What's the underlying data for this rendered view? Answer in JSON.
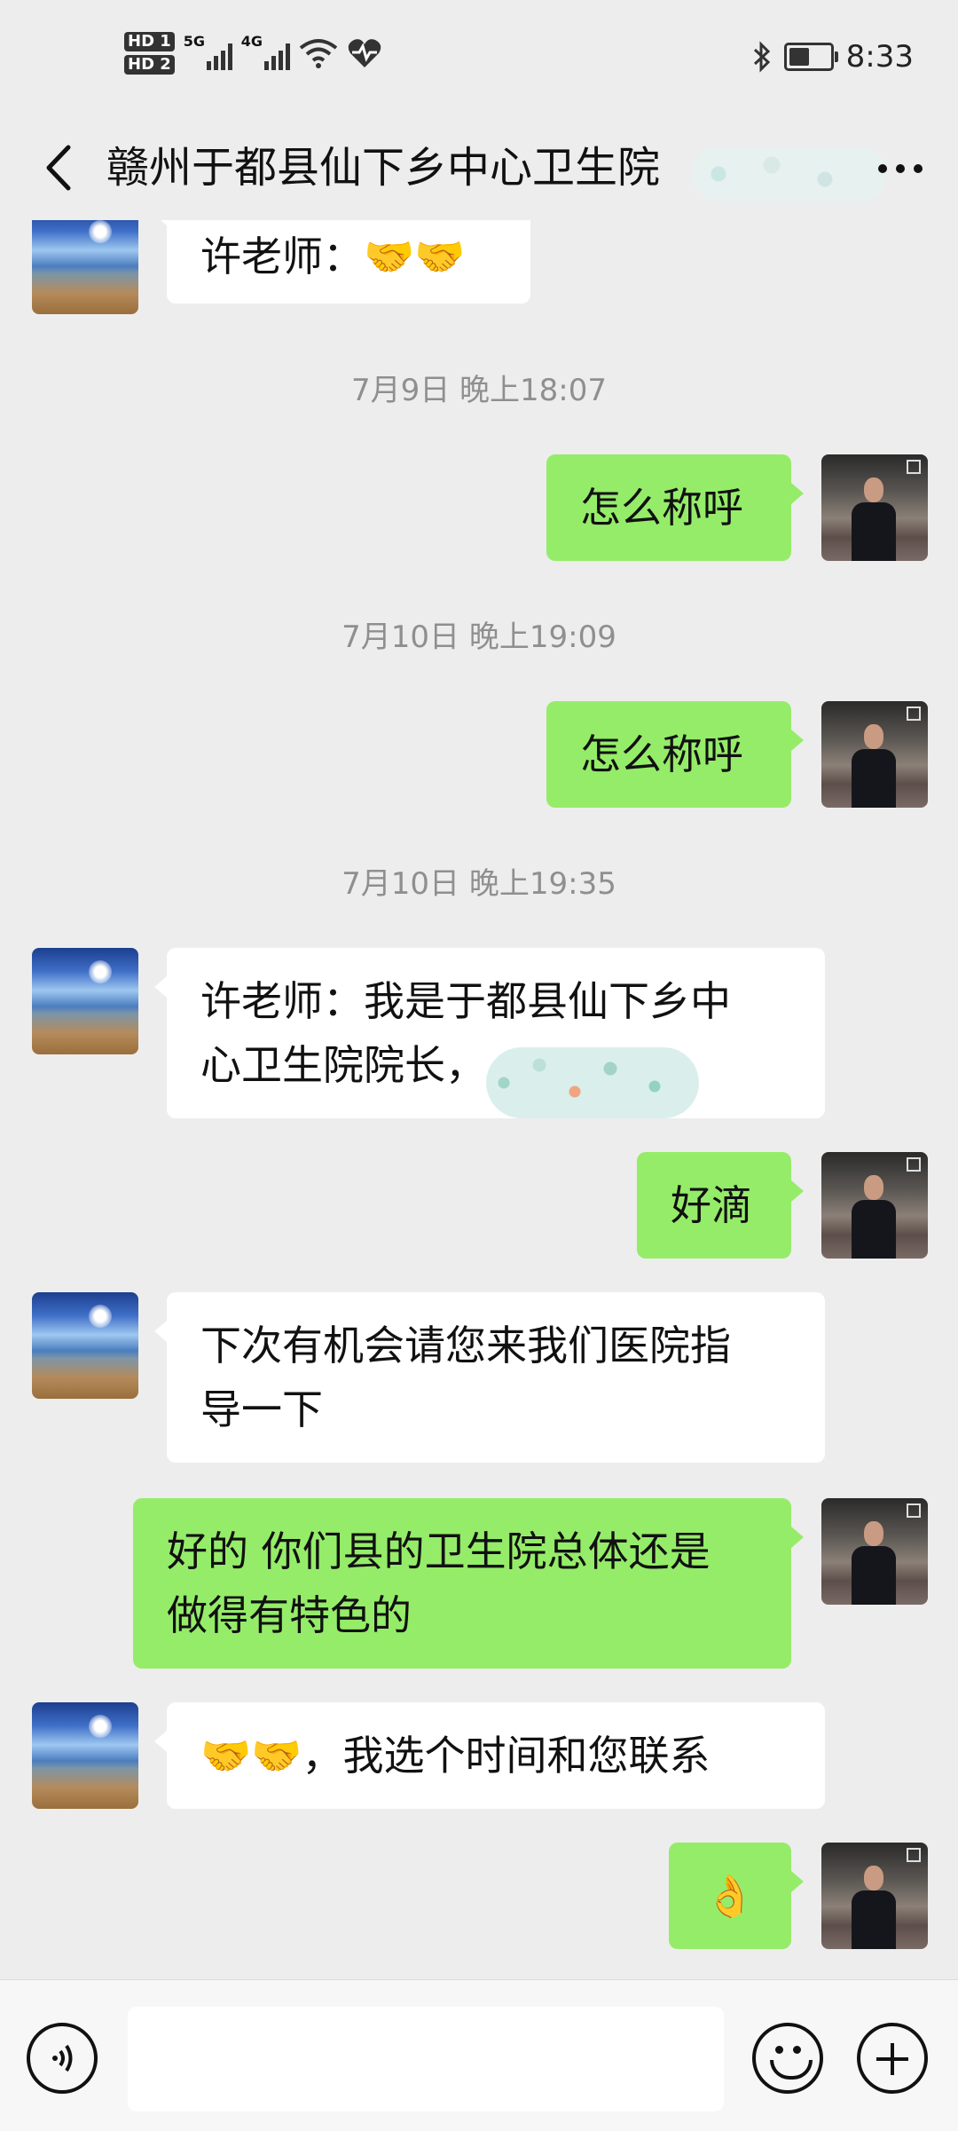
{
  "status_bar": {
    "hd1": "HD 1",
    "hd2": "HD 2",
    "net1": "5G",
    "net2": "4G",
    "time": "8:33",
    "icons": [
      "signal-icon",
      "wifi-icon",
      "heart-rate-icon",
      "bluetooth-icon",
      "battery-icon"
    ],
    "battery_level": 0.5
  },
  "header": {
    "title": "赣州于都县仙下乡中心卫生院",
    "back_icon": "chevron-left-icon",
    "more_icon": "more-dots-icon"
  },
  "messages": [
    {
      "type": "text",
      "side": "left",
      "text": "许老师：🤝🤝"
    },
    {
      "type": "time",
      "text": "7月9日 晚上18:07"
    },
    {
      "type": "text",
      "side": "right",
      "text": "怎么称呼"
    },
    {
      "type": "time",
      "text": "7月10日 晚上19:09"
    },
    {
      "type": "text",
      "side": "right",
      "text": "怎么称呼"
    },
    {
      "type": "time",
      "text": "7月10日 晚上19:35"
    },
    {
      "type": "text",
      "side": "left",
      "lines": [
        "许老师：我是于都县仙下乡中",
        "心卫生院院长，"
      ]
    },
    {
      "type": "text",
      "side": "right",
      "text": "好滴"
    },
    {
      "type": "text",
      "side": "left",
      "lines": [
        "下次有机会请您来我们医院指",
        "导一下"
      ]
    },
    {
      "type": "text",
      "side": "right",
      "lines": [
        "好的 你们县的卫生院总体还是",
        "做得有特色的"
      ]
    },
    {
      "type": "text",
      "side": "left",
      "text": "🤝🤝，我选个时间和您联系"
    },
    {
      "type": "text",
      "side": "right",
      "text": "👌"
    }
  ],
  "input_bar": {
    "voice_icon": "voice-icon",
    "emoji_icon": "emoji-icon",
    "plus_icon": "plus-icon",
    "input_value": ""
  },
  "colors": {
    "background": "#ededed",
    "bubble_sent": "#95ec69",
    "bubble_received": "#ffffff",
    "timestamp": "#8f8f8f"
  }
}
